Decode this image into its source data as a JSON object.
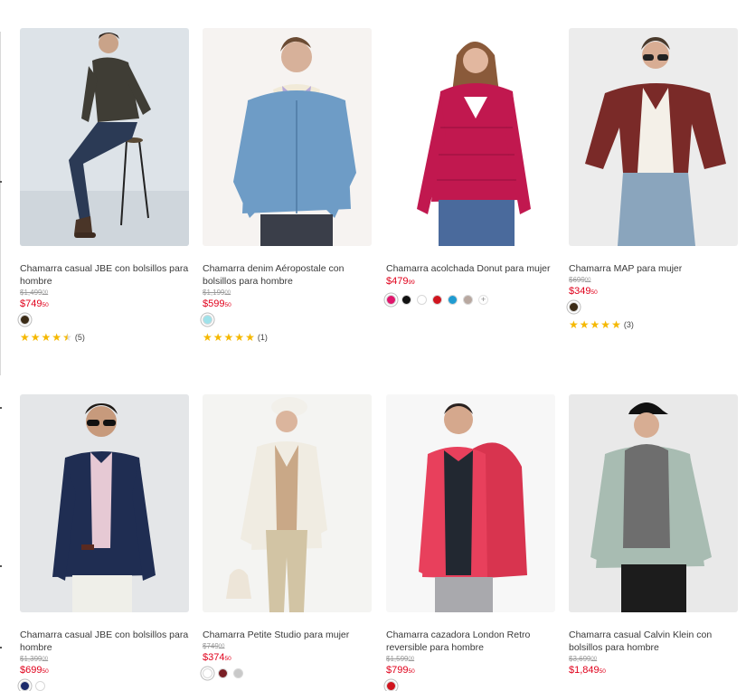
{
  "colors": {
    "price_red": "#e0001b",
    "star_yellow": "#f5b800"
  },
  "products": [
    {
      "title": "Chamarra casual JBE con bolsillos para hombre",
      "old_price": "$1,499",
      "old_cents": "00",
      "price": "$749",
      "price_cents": "50",
      "swatches": [
        "#3b2b16"
      ],
      "rating_stars": 4.5,
      "rating_count": "(5)",
      "image": "man-olive-leather-jacket-on-stool"
    },
    {
      "title": "Chamarra denim Aéropostale con bolsillos para hombre",
      "old_price": "$1,199",
      "old_cents": "00",
      "price": "$599",
      "price_cents": "50",
      "swatches": [
        "#9fe2ea"
      ],
      "rating_stars": 5,
      "rating_count": "(1)",
      "image": "man-denim-sherpa-jacket"
    },
    {
      "title": "Chamarra acolchada Donut para mujer",
      "old_price": "",
      "old_cents": "",
      "price": "$479",
      "price_cents": "99",
      "swatches": [
        "#e0166c",
        "#111111",
        "#ffffff",
        "#d0141e",
        "#1f9bd1",
        "#b8a8a0"
      ],
      "more": "+",
      "rating_stars": 0,
      "rating_count": "",
      "image": "woman-magenta-puffer-jacket"
    },
    {
      "title": "Chamarra MAP para mujer",
      "old_price": "$699",
      "old_cents": "00",
      "price": "$349",
      "price_cents": "50",
      "swatches": [
        "#3b2b16"
      ],
      "rating_stars": 5,
      "rating_count": "(3)",
      "image": "woman-maroon-cropped-jacket"
    },
    {
      "title": "Chamarra casual JBE con bolsillos para hombre",
      "old_price": "$1,399",
      "old_cents": "00",
      "price": "$699",
      "price_cents": "50",
      "swatches": [
        "#1b2a6b",
        "#ffffff"
      ],
      "rating_stars": 0,
      "rating_count": "",
      "image": "man-navy-jacket-sunglasses"
    },
    {
      "title": "Chamarra Petite Studio para mujer",
      "old_price": "$749",
      "old_cents": "00",
      "price": "$374",
      "price_cents": "50",
      "swatches": [
        "#ffffff",
        "#7a1f25",
        "#c9c9c9"
      ],
      "rating_stars": 0,
      "rating_count": "",
      "image": "woman-white-jacket-beret"
    },
    {
      "title": "Chamarra cazadora London Retro reversible para hombre",
      "old_price": "$1,599",
      "old_cents": "00",
      "price": "$799",
      "price_cents": "50",
      "swatches": [
        "#d0141e"
      ],
      "rating_stars": 0,
      "rating_count": "",
      "image": "man-red-hooded-jacket"
    },
    {
      "title": "Chamarra casual Calvin Klein con bolsillos para hombre",
      "old_price": "$3,699",
      "old_cents": "00",
      "price": "$1,849",
      "price_cents": "50",
      "swatches": [],
      "rating_stars": 0,
      "rating_count": "",
      "image": "man-sage-jacket-cap"
    }
  ]
}
